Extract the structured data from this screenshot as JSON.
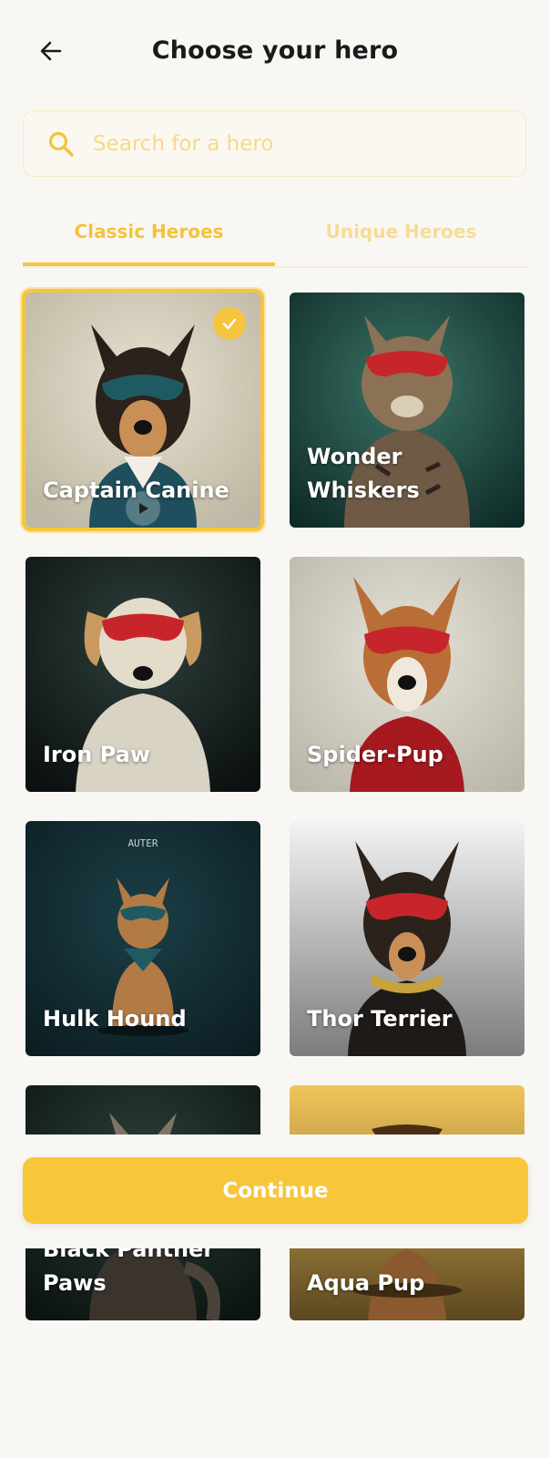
{
  "header": {
    "title": "Choose your hero",
    "back_icon": "arrow-left-icon"
  },
  "search": {
    "placeholder": "Search for a hero",
    "value": "",
    "icon": "search-icon"
  },
  "tabs": [
    {
      "label": "Classic Heroes",
      "active": true
    },
    {
      "label": "Unique Heroes",
      "active": false
    }
  ],
  "heroes": [
    {
      "name": "Captain Canine",
      "selected": true,
      "mask_color": "#1f5a63"
    },
    {
      "name": "Wonder Whiskers",
      "selected": false,
      "mask_color": "#c6262b"
    },
    {
      "name": "Iron Paw",
      "selected": false,
      "mask_color": "#c6262b"
    },
    {
      "name": "Spider-Pup",
      "selected": false,
      "mask_color": "#c6262b"
    },
    {
      "name": "Hulk Hound",
      "selected": false,
      "mask_color": "#1f5a63",
      "poster_text": "AUTER"
    },
    {
      "name": "Thor Terrier",
      "selected": false,
      "mask_color": "#c6262b"
    },
    {
      "name": "Black Panther Paws",
      "selected": false
    },
    {
      "name": "Aqua Pup",
      "selected": false
    }
  ],
  "footer": {
    "continue_label": "Continue"
  },
  "colors": {
    "accent": "#f6c53f",
    "background": "#f8f7f3"
  }
}
